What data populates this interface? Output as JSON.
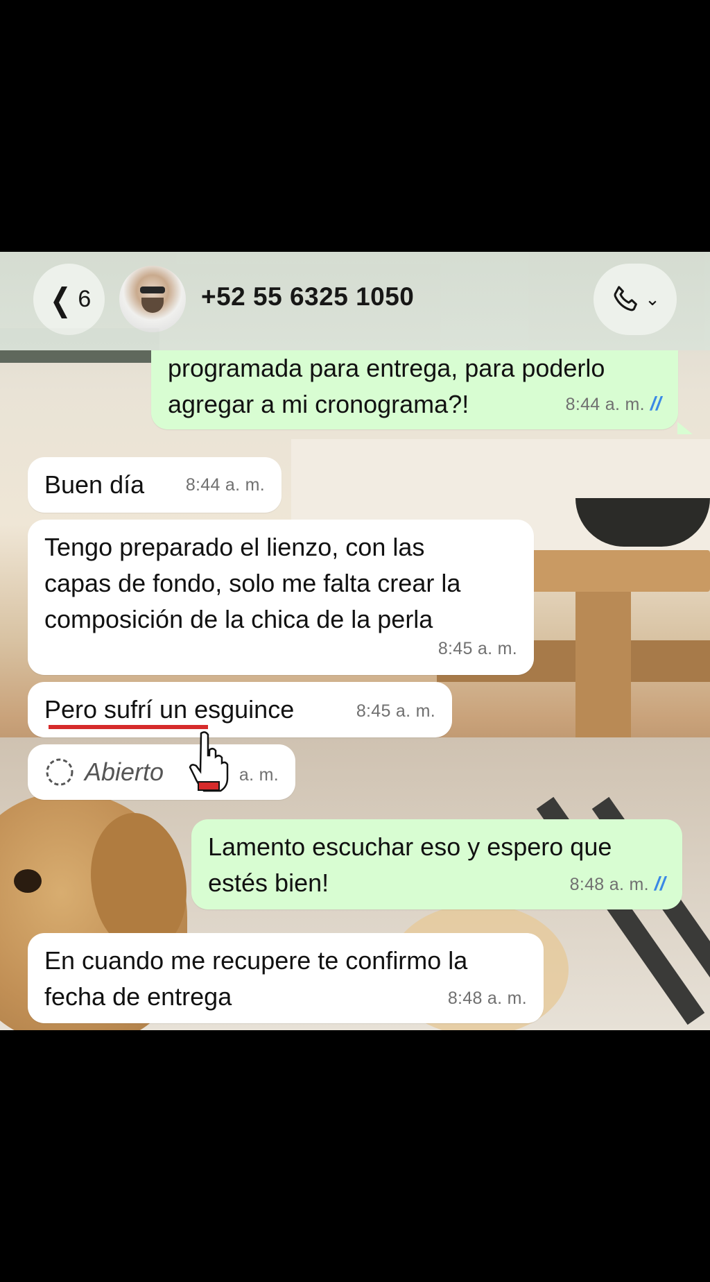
{
  "header": {
    "back_count": "6",
    "contact_name": "+52 55 6325 1050"
  },
  "messages": [
    {
      "direction": "out",
      "text_lines": [
        "programada para entrega, para poderlo",
        "agregar a mi cronograma?!"
      ],
      "time": "8:44 a. m.",
      "read": true
    },
    {
      "direction": "in",
      "text_lines": [
        "Buen día"
      ],
      "time": "8:44 a. m."
    },
    {
      "direction": "in",
      "text_lines": [
        "Tengo preparado el lienzo, con las",
        "capas de fondo, solo me falta crear la",
        "composición de la chica de la perla"
      ],
      "time": "8:45 a. m."
    },
    {
      "direction": "in",
      "text_lines": [
        "Pero sufrí un esguince"
      ],
      "time": "8:45 a. m."
    },
    {
      "direction": "in",
      "kind": "view-once",
      "text_lines": [
        "Abierto"
      ],
      "time": "a. m."
    },
    {
      "direction": "out",
      "text_lines": [
        "Lamento escuchar eso y espero que",
        "estés bien!"
      ],
      "time": "8:48 a. m.",
      "read": true
    },
    {
      "direction": "in",
      "text_lines": [
        "En cuando me recupere te confirmo la",
        "fecha de entrega"
      ],
      "time": "8:48 a. m."
    }
  ],
  "icons": {
    "back": "chevron-left-icon",
    "call": "phone-icon",
    "call_menu": "chevron-down-icon",
    "view_once": "dashed-circle-icon",
    "read_receipt": "double-check-icon",
    "pointer": "hand-pointer-icon"
  },
  "colors": {
    "outgoing_bubble": "#d8fdd2",
    "incoming_bubble": "#ffffff",
    "read_ticks": "#3a88e6",
    "highlight_underline": "#d62b2b"
  }
}
